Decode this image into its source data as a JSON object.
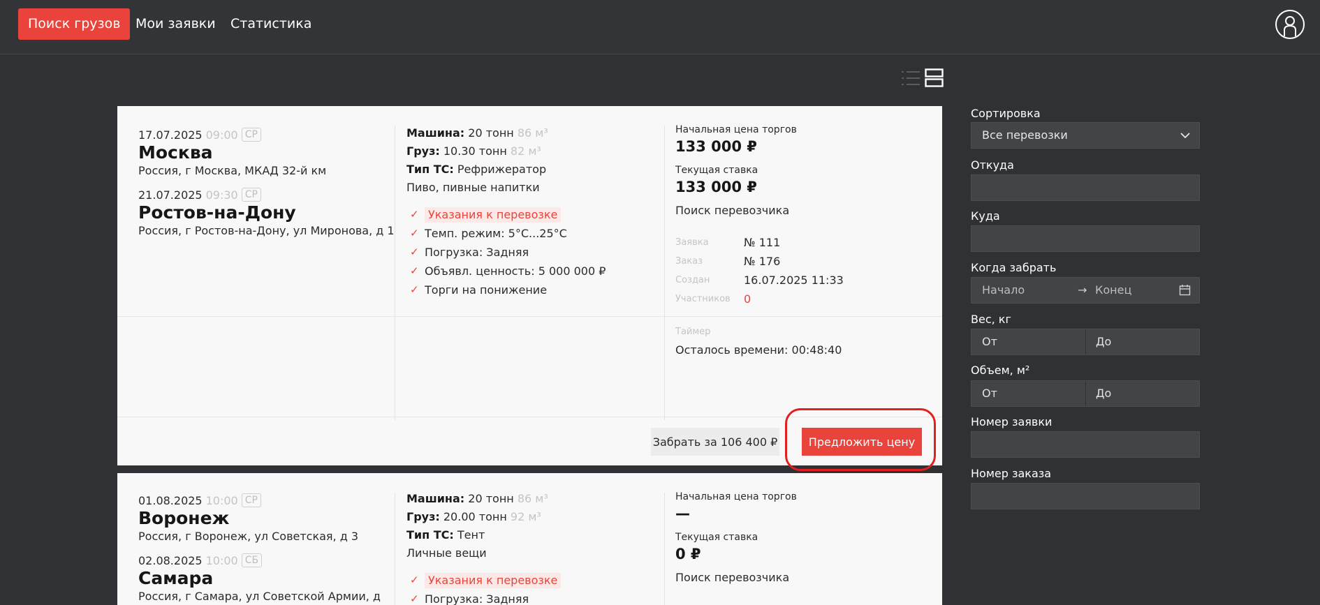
{
  "nav": {
    "tabs": [
      {
        "label": "Поиск грузов",
        "active": true
      },
      {
        "label": "Мои заявки",
        "active": false
      },
      {
        "label": "Статистика",
        "active": false
      }
    ],
    "profile_icon": "user-circle-icon"
  },
  "view_toggle": {
    "list_icon": "list-view-icon",
    "cards_icon": "card-view-icon"
  },
  "cards": [
    {
      "pickup": {
        "date": "17.07.2025",
        "time": "09:00",
        "dow": "СР",
        "city": "Москва",
        "address": "Россия, г Москва, МКАД 32-й км"
      },
      "delivery": {
        "date": "21.07.2025",
        "time": "09:30",
        "dow": "СР",
        "city": "Ростов-на-Дону",
        "address": "Россия, г Ростов-на-Дону, ул Миронова, д 1"
      },
      "vehicle_label": "Машина:",
      "vehicle_value": "20 тонн",
      "vehicle_volume": "86 м³",
      "cargo_label": "Груз:",
      "cargo_value": "10.30 тонн",
      "cargo_volume": "82 м³",
      "ts_label": "Тип ТС:",
      "ts_value": "Рефрижератор",
      "goods": "Пиво, пивные напитки",
      "checks": [
        "Указания к перевозке",
        "Темп. режим: 5°C...25°C",
        "Погрузка: Задняя",
        "Объявл. ценность: 5 000 000 ₽",
        "Торги на понижение"
      ],
      "start_price_label": "Начальная цена торгов",
      "start_price": "133 000 ₽",
      "current_bid_label": "Текущая ставка",
      "current_bid": "133 000 ₽",
      "status": "Поиск перевозчика",
      "meta": [
        {
          "key": "Заявка",
          "value": "№ 111"
        },
        {
          "key": "Заказ",
          "value": "№ 176"
        },
        {
          "key": "Создан",
          "value": "16.07.2025 11:33"
        },
        {
          "key": "Участников",
          "value": "0"
        }
      ],
      "timer_label": "Таймер",
      "timer_value": "Осталось времени: 00:48:40",
      "take_button": "Забрать за 106 400 ₽",
      "offer_button": "Предложить цену"
    },
    {
      "pickup": {
        "date": "01.08.2025",
        "time": "10:00",
        "dow": "СР",
        "city": "Воронеж",
        "address": "Россия, г Воронеж, ул Советская, д 3"
      },
      "delivery": {
        "date": "02.08.2025",
        "time": "10:00",
        "dow": "СБ",
        "city": "Самара",
        "address": "Россия, г Самара, ул Советской Армии, д"
      },
      "vehicle_label": "Машина:",
      "vehicle_value": "20 тонн",
      "vehicle_volume": "86 м³",
      "cargo_label": "Груз:",
      "cargo_value": "20.00 тонн",
      "cargo_volume": "92 м³",
      "ts_label": "Тип ТС:",
      "ts_value": "Тент",
      "goods": "Личные вещи",
      "checks": [
        "Указания к перевозке",
        "Погрузка: Задняя"
      ],
      "start_price_label": "Начальная цена торгов",
      "start_price": "—",
      "current_bid_label": "Текущая ставка",
      "current_bid": "0 ₽",
      "status": "Поиск перевозчика"
    }
  ],
  "filters": {
    "sort_label": "Сортировка",
    "sort_value": "Все перевозки",
    "from_label": "Откуда",
    "to_label": "Куда",
    "when_label": "Когда забрать",
    "when_start": "Начало",
    "when_end": "Конец",
    "weight_label": "Вес, кг",
    "weight_from": "От",
    "weight_to": "До",
    "volume_label": "Объем, м²",
    "volume_from": "От",
    "volume_to": "До",
    "request_no_label": "Номер заявки",
    "order_no_label": "Номер заказа"
  },
  "colors": {
    "accent": "#e9433b",
    "background": "#303134",
    "card": "#f8f8f8"
  }
}
